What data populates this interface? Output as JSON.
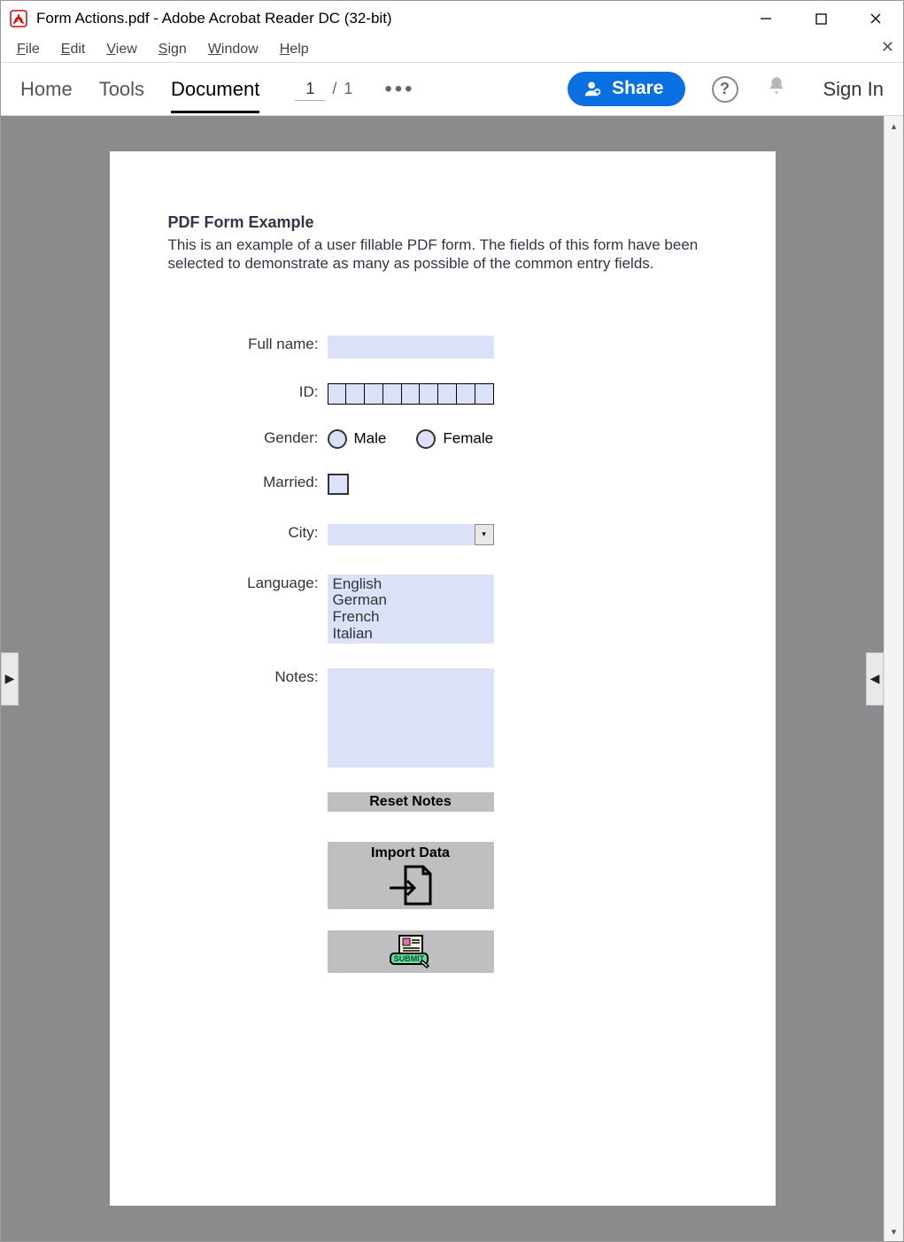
{
  "window": {
    "title": "Form Actions.pdf - Adobe Acrobat Reader DC (32-bit)"
  },
  "menu": {
    "file": "File",
    "edit": "Edit",
    "view": "View",
    "sign": "Sign",
    "window": "Window",
    "help": "Help"
  },
  "toolbar": {
    "home": "Home",
    "tools": "Tools",
    "document": "Document",
    "page_current": "1",
    "page_sep": "/",
    "page_total": "1",
    "share": "Share",
    "signin": "Sign In"
  },
  "pdf": {
    "heading": "PDF Form Example",
    "desc": "This is an example of a user fillable PDF form. The fields of this form have been selected to demonstrate as many as possible of the common entry fields.",
    "labels": {
      "fullname": "Full name:",
      "id": "ID:",
      "gender": "Gender:",
      "married": "Married:",
      "city": "City:",
      "language": "Language:",
      "notes": "Notes:"
    },
    "gender_options": {
      "male": "Male",
      "female": "Female"
    },
    "language_options": [
      "English",
      "German",
      "French",
      "Italian"
    ],
    "buttons": {
      "reset": "Reset Notes",
      "import": "Import Data",
      "submit": "SUBMIT"
    }
  }
}
